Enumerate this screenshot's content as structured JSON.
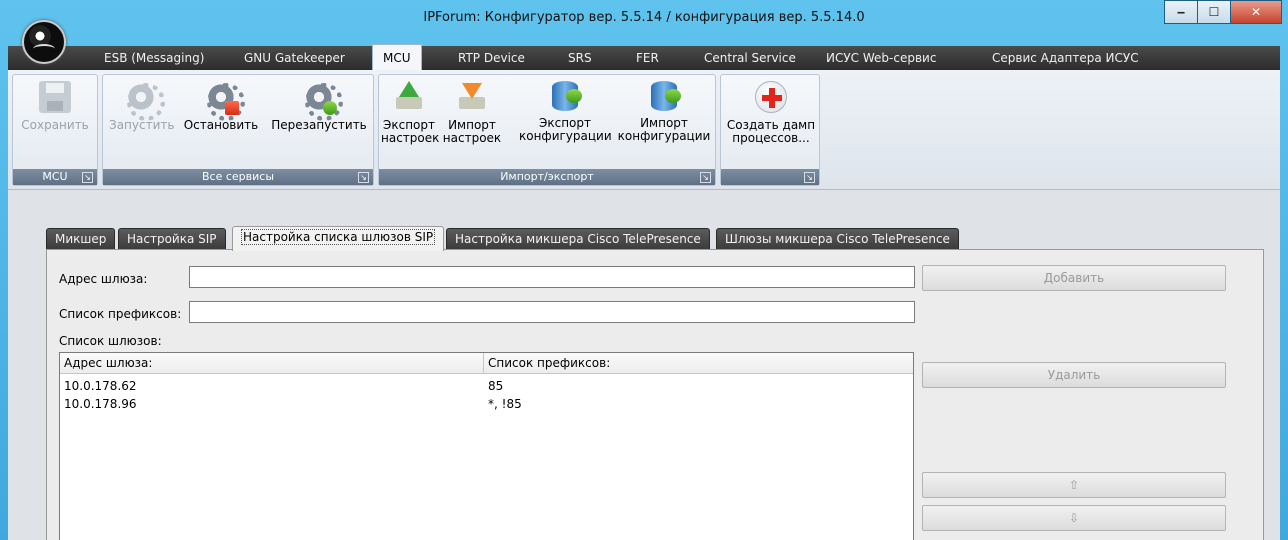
{
  "window": {
    "title": "IPForum: Конфигуратор вер. 5.5.14 / конфигурация вер. 5.5.14.0",
    "minimize": "‒",
    "maximize": "☐",
    "close": "✕"
  },
  "ribbon_tabs": [
    {
      "label": "ESB (Messaging)"
    },
    {
      "label": "GNU Gatekeeper"
    },
    {
      "label": "MCU"
    },
    {
      "label": "RTP Device"
    },
    {
      "label": "SRS"
    },
    {
      "label": "FER"
    },
    {
      "label": "Central Service"
    },
    {
      "label": "ИСУС Web-сервис"
    },
    {
      "label": "Сервис Адаптера ИСУС"
    }
  ],
  "ribbon": {
    "groups": [
      {
        "label": "MCU",
        "buttons": [
          {
            "label": "Сохранить",
            "icon": "save-icon",
            "enabled": false
          }
        ]
      },
      {
        "label": "Все сервисы",
        "buttons": [
          {
            "label": "Запустить",
            "icon": "gear-start-icon",
            "enabled": false
          },
          {
            "label": "Остановить",
            "icon": "gear-stop-icon",
            "enabled": true
          },
          {
            "label": "Перезапустить",
            "icon": "gear-restart-icon",
            "enabled": true
          }
        ]
      },
      {
        "label": "Импорт/экспорт",
        "buttons": [
          {
            "label1": "Экспорт",
            "label2": "настроек",
            "icon": "export-settings-icon"
          },
          {
            "label1": "Импорт",
            "label2": "настроек",
            "icon": "import-settings-icon"
          },
          {
            "label1": "Экспорт",
            "label2": "конфигурации",
            "icon": "export-config-icon"
          },
          {
            "label1": "Импорт",
            "label2": "конфигурации",
            "icon": "import-config-icon"
          }
        ]
      },
      {
        "label": "",
        "buttons": [
          {
            "label1": "Создать дамп",
            "label2": "процессов...",
            "icon": "dump-icon"
          }
        ]
      }
    ],
    "launcher": "↘"
  },
  "doc_tabs": [
    {
      "label": "Микшер"
    },
    {
      "label": "Настройка SIP"
    },
    {
      "label": "Настройка списка шлюзов SIP"
    },
    {
      "label": "Настройка микшера Cisco TelePresence"
    },
    {
      "label": "Шлюзы микшера Cisco TelePresence"
    }
  ],
  "form": {
    "gateway_address_label": "Адрес шлюза:",
    "gateway_address_value": "",
    "prefixes_label": "Список префиксов:",
    "prefixes_value": "",
    "gateways_list_label": "Список шлюзов:",
    "add_button": "Добавить",
    "delete_button": "Удалить",
    "move_up": "⇧",
    "move_down": "⇩"
  },
  "gateways_table": {
    "columns": [
      "Адрес шлюза:",
      "Список префиксов:"
    ],
    "rows": [
      [
        "10.0.178.62",
        "85"
      ],
      [
        "10.0.178.96",
        "*, !85"
      ]
    ]
  }
}
